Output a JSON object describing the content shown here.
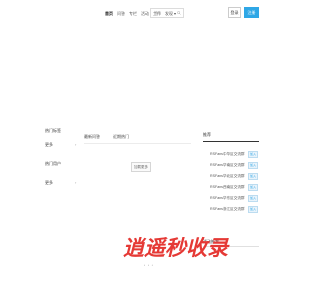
{
  "header": {
    "nav": [
      {
        "label": "首页",
        "active": true
      },
      {
        "label": "问答",
        "active": false
      },
      {
        "label": "专栏",
        "active": false
      },
      {
        "label": "活动",
        "active": false
      },
      {
        "label": "工作",
        "active": false
      },
      {
        "label": "发现",
        "active": false,
        "dropdown": true
      }
    ],
    "search": {
      "placeholder": "搜索",
      "icon": "search-icon"
    },
    "login_label": "登录",
    "register_label": "注册"
  },
  "sidebar": {
    "section1_title": "热门标签",
    "section1_more": "更多",
    "section2_title": "热门用户",
    "section2_more": "更多"
  },
  "main": {
    "tabs": [
      {
        "label": "最新问答",
        "active": true
      },
      {
        "label": "近期热门",
        "active": false
      }
    ],
    "load_more_label": "加载更多"
  },
  "right": {
    "title": "推荐",
    "items": [
      {
        "text": "RSFans中华区交流群",
        "button": "加入"
      },
      {
        "text": "RSFans华南区交流群",
        "button": "加入"
      },
      {
        "text": "RSFans华北区交流群",
        "button": "加入"
      },
      {
        "text": "RSFans西南区交流群",
        "button": "加入"
      },
      {
        "text": "RSFans华东区交流群",
        "button": "加入"
      },
      {
        "text": "RSFans浙江区交流群",
        "button": "加入"
      }
    ],
    "bottom_title": "活动推荐"
  },
  "banner": {
    "text": "逍遥秒收录",
    "color": "#e53935",
    "dots": "• • •"
  },
  "colors": {
    "accent": "#2fa7e6",
    "banner": "#e53935"
  }
}
